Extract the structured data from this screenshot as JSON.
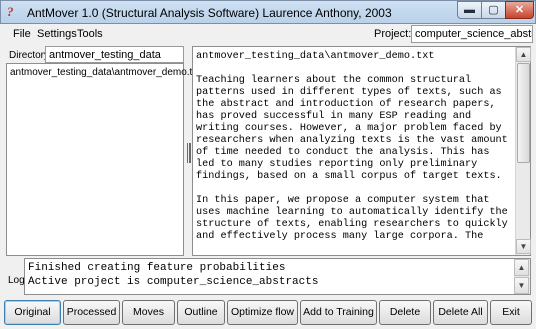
{
  "window": {
    "title": "AntMover 1.0 (Structural Analysis Software) Laurence Anthony, 2003",
    "icon": "antmover-app-icon",
    "controls": {
      "minimize": "▬",
      "maximize": "▢",
      "close": "✕"
    }
  },
  "menu": [
    {
      "label": "File"
    },
    {
      "label": "Settings"
    },
    {
      "label": "Tools"
    }
  ],
  "project": {
    "label": "Project:",
    "value": "computer_science_abstracts"
  },
  "directory": {
    "label": "Directory",
    "value": "antmover_testing_data"
  },
  "files": [
    "antmover_testing_data\\antmover_demo.txt"
  ],
  "viewer": {
    "text": "antmover_testing_data\\antmover_demo.txt\n\nTeaching learners about the common structural\npatterns used in different types of texts, such as\nthe abstract and introduction of research papers,\nhas proved successful in many ESP reading and\nwriting courses. However, a major problem faced by\nresearchers when analyzing texts is the vast amount\nof time needed to conduct the analysis. This has\nled to many studies reporting only preliminary\nfindings, based on a small corpus of target texts.\n\nIn this paper, we propose a computer system that\nuses machine learning to automatically identify the\nstructure of texts, enabling researchers to quickly\nand effectively process many large corpora. The"
  },
  "log": {
    "label": "Log",
    "lines": [
      "Finished creating feature probabilities",
      "Active project is computer_science_abstracts"
    ]
  },
  "buttons": [
    {
      "label": "Original",
      "active": true
    },
    {
      "label": "Processed"
    },
    {
      "label": "Moves"
    },
    {
      "label": "Outline"
    },
    {
      "label": "Optimize flow"
    },
    {
      "label": "Add to Training"
    },
    {
      "label": "Delete"
    },
    {
      "label": "Delete All"
    },
    {
      "label": "Exit"
    }
  ],
  "colors": {
    "accent": "#c0392b",
    "titlebar": "#b9d1ea",
    "close": "#c7442b"
  }
}
